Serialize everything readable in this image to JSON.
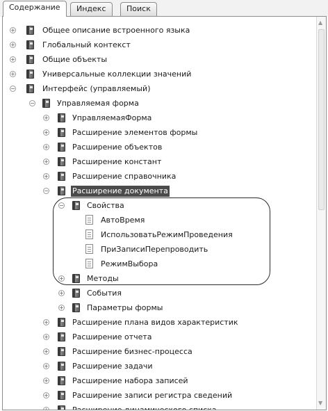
{
  "tabs": {
    "contents": "Содержание",
    "index": "Индекс",
    "search": "Поиск"
  },
  "tree": {
    "general_description": "Общее описание встроенного языка",
    "global_context": "Глобальный контекст",
    "common_objects": "Общие объекты",
    "universal_collections": "Универсальные коллекции значений",
    "managed_interface": "Интерфейс (управляемый)",
    "managed_form": "Управляемая форма",
    "managed_form_object": "УправляемаяФорма",
    "form_elements_ext": "Расширение элементов формы",
    "objects_ext": "Расширение объектов",
    "constants_ext": "Расширение констант",
    "catalog_ext": "Расширение справочника",
    "document_ext": "Расширение документа",
    "properties": "Свойства",
    "prop_autotime": "АвтоВремя",
    "prop_use_posting_mode": "ИспользоватьРежимПроведения",
    "prop_repost_on_write": "ПриЗаписиПерепроводить",
    "prop_choice_mode": "РежимВыбора",
    "methods": "Методы",
    "events": "События",
    "form_parameters": "Параметры формы",
    "char_types_plan_ext": "Расширение плана видов характеристик",
    "report_ext": "Расширение отчета",
    "business_process_ext": "Расширение бизнес-процесса",
    "task_ext": "Расширение задачи",
    "record_set_ext": "Расширение набора записей",
    "info_register_record_ext": "Расширение записи регистра сведений",
    "dynamic_list_ext": "Расширение динамического списка"
  },
  "expander_glyphs": {
    "collapsed": "+",
    "expanded": "−"
  },
  "scrollbar": {
    "up": "▲",
    "down": "▼"
  }
}
